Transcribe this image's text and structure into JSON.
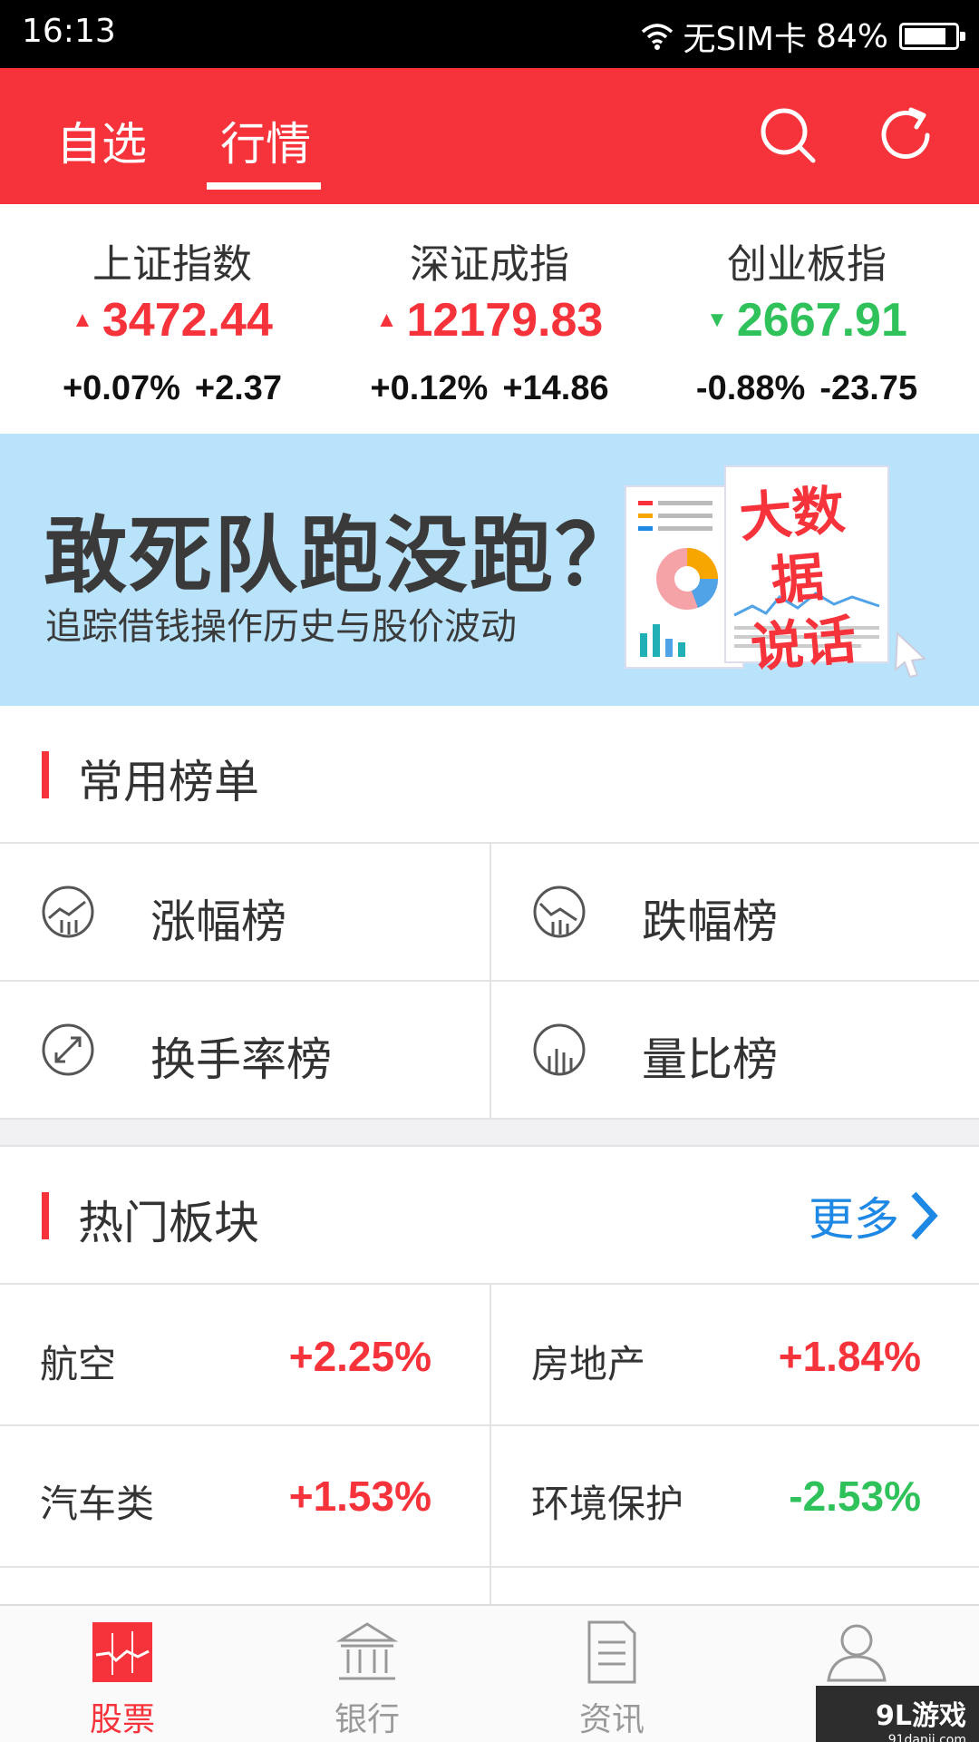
{
  "status_bar": {
    "time": "16:13",
    "carrier": "无SIM卡",
    "battery": "84%",
    "battery_level": 0.84
  },
  "header": {
    "tabs": [
      {
        "label": "自选",
        "active": false
      },
      {
        "label": "行情",
        "active": true
      }
    ]
  },
  "indices": [
    {
      "name": "上证指数",
      "value": "3472.44",
      "direction": "up",
      "pct": "+0.07%",
      "change": "+2.37"
    },
    {
      "name": "深证成指",
      "value": "12179.83",
      "direction": "up",
      "pct": "+0.12%",
      "change": "+14.86"
    },
    {
      "name": "创业板指",
      "value": "2667.91",
      "direction": "down",
      "pct": "-0.88%",
      "change": "-23.75"
    }
  ],
  "banner": {
    "title": "敢死队跑没跑？",
    "subtitle": "追踪借钱操作历史与股价波动",
    "badge_line1": "大数据",
    "badge_line2": "说话"
  },
  "common_lists": {
    "title": "常用榜单",
    "items": [
      {
        "label": "涨幅榜",
        "icon": "rise-chart-icon"
      },
      {
        "label": "跌幅榜",
        "icon": "fall-chart-icon"
      },
      {
        "label": "换手率榜",
        "icon": "turnover-icon"
      },
      {
        "label": "量比榜",
        "icon": "volume-ratio-icon"
      }
    ]
  },
  "hot_sectors": {
    "title": "热门板块",
    "more_label": "更多",
    "items": [
      {
        "name": "航空",
        "pct": "+2.25%",
        "direction": "up"
      },
      {
        "name": "房地产",
        "pct": "+1.84%",
        "direction": "up"
      },
      {
        "name": "汽车类",
        "pct": "+1.53%",
        "direction": "up"
      },
      {
        "name": "环境保护",
        "pct": "-2.53%",
        "direction": "down"
      }
    ]
  },
  "bottom_nav": [
    {
      "label": "股票",
      "icon": "stock-icon",
      "active": true
    },
    {
      "label": "银行",
      "icon": "bank-icon",
      "active": false
    },
    {
      "label": "资讯",
      "icon": "news-icon",
      "active": false
    },
    {
      "label": "",
      "icon": "user-icon",
      "active": false
    }
  ],
  "watermark": {
    "brand": "9L游戏",
    "url": "91danji.com"
  },
  "colors": {
    "accent": "#f6333b",
    "up": "#f6333b",
    "down": "#2fc25b",
    "link": "#1e88e5",
    "banner_bg": "#b9e3fa"
  }
}
